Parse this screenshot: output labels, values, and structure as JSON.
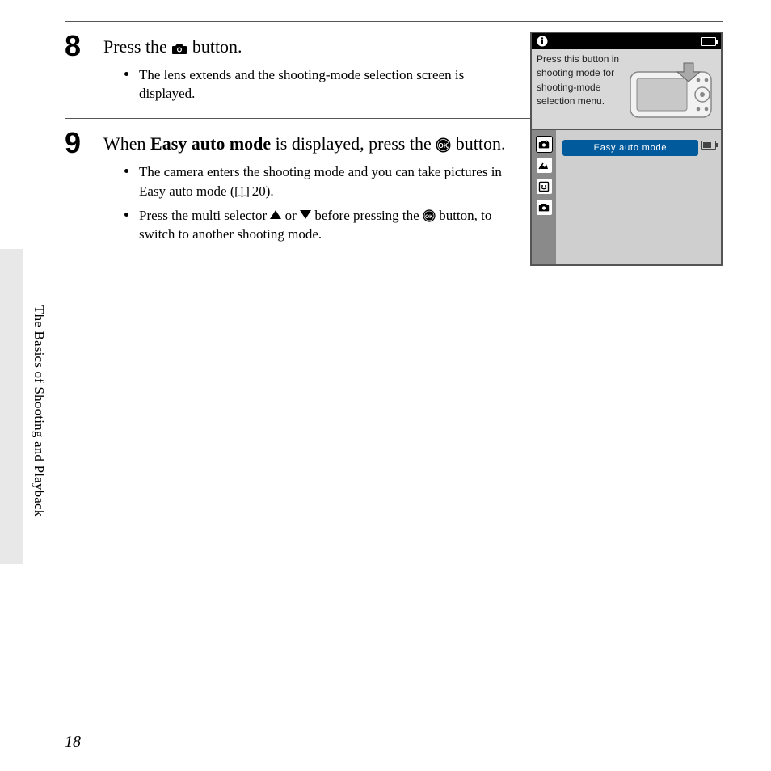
{
  "page_number": "18",
  "side_label": "The Basics of Shooting and Playback",
  "step8": {
    "num": "8",
    "title_pre": "Press the ",
    "title_post": " button.",
    "bullet1": "The lens extends and the shooting-mode selection screen is displayed.",
    "screen_msg": "Press this button in shooting mode for shooting-mode selection menu."
  },
  "step9": {
    "num": "9",
    "title_pre": "When ",
    "title_bold": "Easy auto mode",
    "title_mid": " is displayed, press the ",
    "title_post": " button.",
    "bullet1_pre": "The camera enters the shooting mode and you can take pictures in Easy auto mode (",
    "bullet1_ref": " 20).",
    "bullet2_a": "Press the multi selector ",
    "bullet2_b": " or ",
    "bullet2_c": " before pressing the ",
    "bullet2_d": " button, to switch to another shooting mode.",
    "mode_label": "Easy auto mode"
  }
}
